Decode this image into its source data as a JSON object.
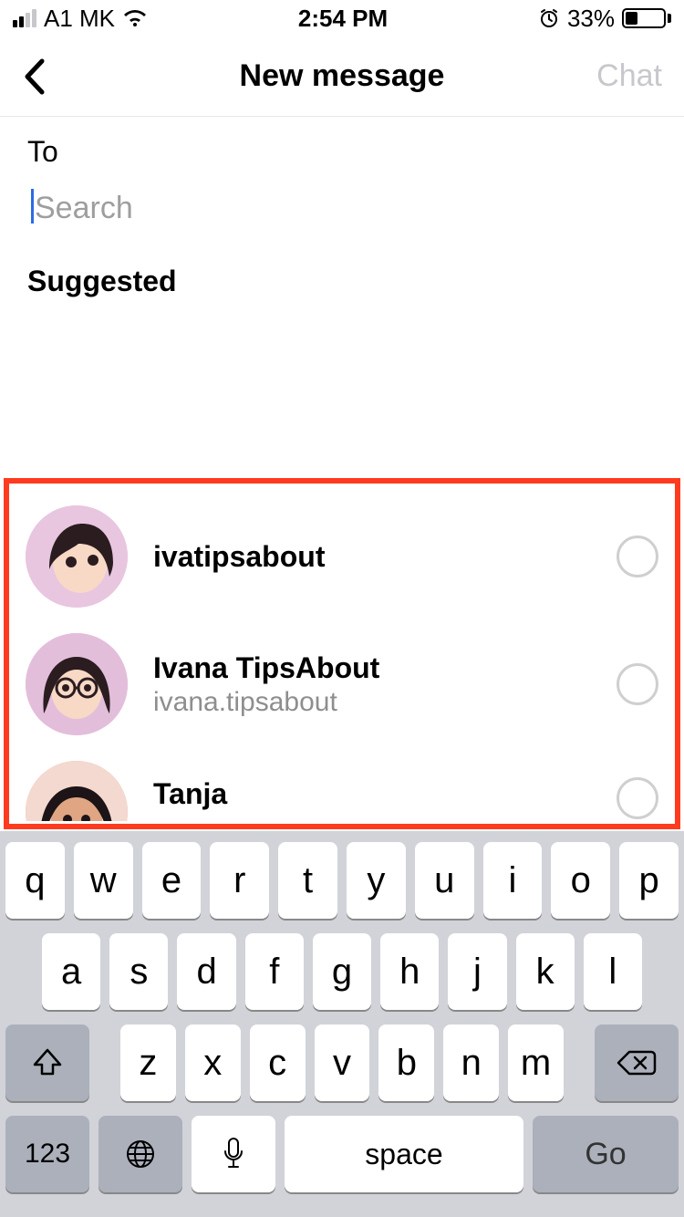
{
  "status": {
    "carrier": "A1 MK",
    "time": "2:54 PM",
    "battery_pct": "33%",
    "battery_fill_pct": 33
  },
  "nav": {
    "title": "New message",
    "action": "Chat"
  },
  "compose": {
    "to_label": "To",
    "search_placeholder": "Search",
    "suggested_label": "Suggested"
  },
  "suggested": [
    {
      "name": "ivatipsabout",
      "sub": ""
    },
    {
      "name": "Ivana TipsAbout",
      "sub": "ivana.tipsabout"
    },
    {
      "name": "Tanja",
      "sub": ""
    }
  ],
  "keyboard": {
    "row1": [
      "q",
      "w",
      "e",
      "r",
      "t",
      "y",
      "u",
      "i",
      "o",
      "p"
    ],
    "row2": [
      "a",
      "s",
      "d",
      "f",
      "g",
      "h",
      "j",
      "k",
      "l"
    ],
    "row3": [
      "z",
      "x",
      "c",
      "v",
      "b",
      "n",
      "m"
    ],
    "num": "123",
    "space": "space",
    "go": "Go"
  }
}
